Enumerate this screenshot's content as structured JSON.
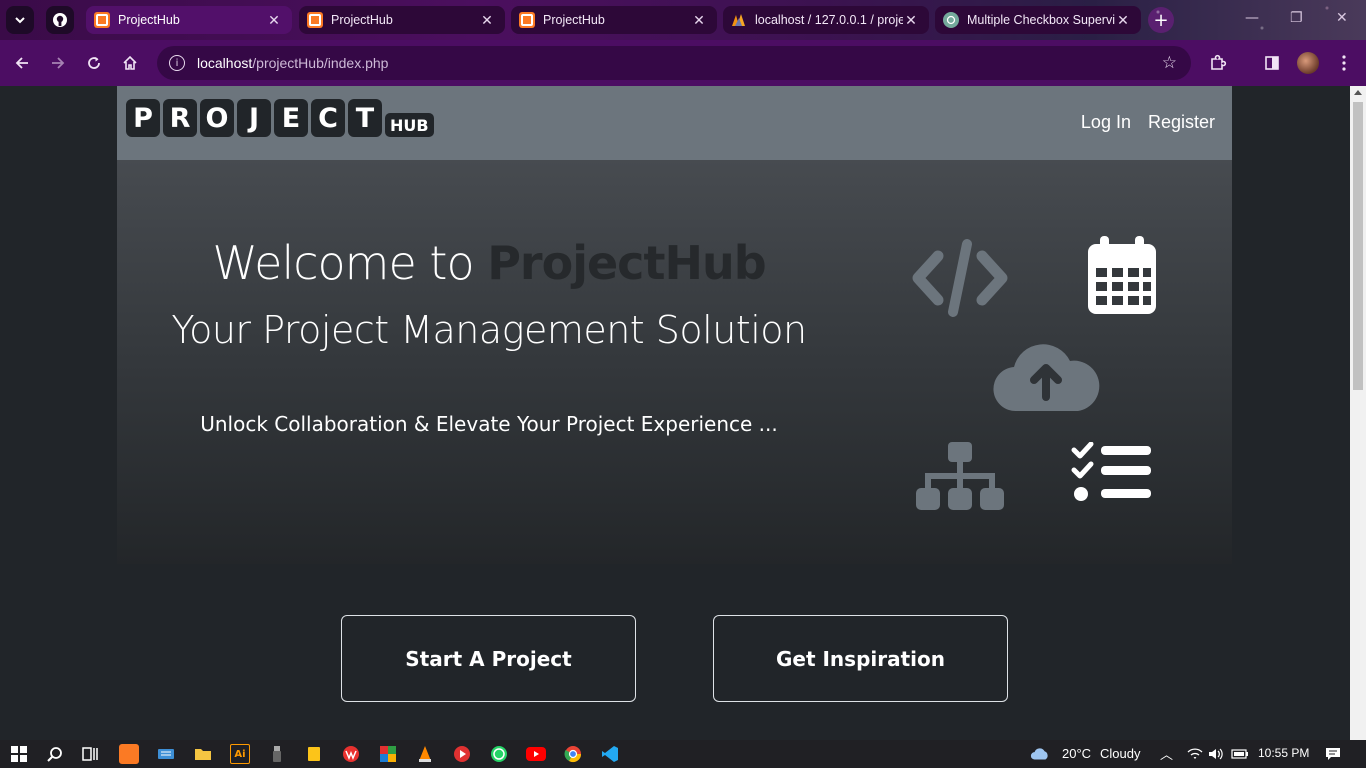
{
  "browser": {
    "tabs": [
      {
        "title": "ProjectHub",
        "favicon": "xampp-icon",
        "active": true
      },
      {
        "title": "ProjectHub",
        "favicon": "xampp-icon",
        "active": false
      },
      {
        "title": "ProjectHub",
        "favicon": "xampp-icon",
        "active": false
      },
      {
        "title": "localhost / 127.0.0.1 / proje",
        "favicon": "phpmyadmin-icon",
        "active": false
      },
      {
        "title": "Multiple Checkbox Supervi",
        "favicon": "chatgpt-icon",
        "active": false
      }
    ],
    "url_host": "localhost",
    "url_path": "/projectHub/index.php",
    "accent_color": "#4c0d63"
  },
  "site": {
    "logo_letters": [
      "P",
      "R",
      "O",
      "J",
      "E",
      "C",
      "T"
    ],
    "logo_suffix": "HUB",
    "nav": {
      "login": "Log In",
      "register": "Register"
    },
    "hero": {
      "title_prefix": "Welcome to ",
      "title_brand": "ProjectHub",
      "subtitle": "Your Project Management Solution",
      "tagline": "Unlock Collaboration & Elevate Your Project Experience ..."
    },
    "hero_icons": [
      "code-icon",
      "calendar-icon",
      "cloud-upload-icon",
      "sitemap-icon",
      "checklist-icon"
    ],
    "buttons": {
      "start": "Start A Project",
      "inspire": "Get Inspiration"
    },
    "colors": {
      "navbar": "#6c757d",
      "background": "#212529",
      "brand_text": "#26292c"
    }
  },
  "taskbar": {
    "weather_temp": "20°C",
    "weather_desc": "Cloudy",
    "time": "10:55 PM"
  }
}
